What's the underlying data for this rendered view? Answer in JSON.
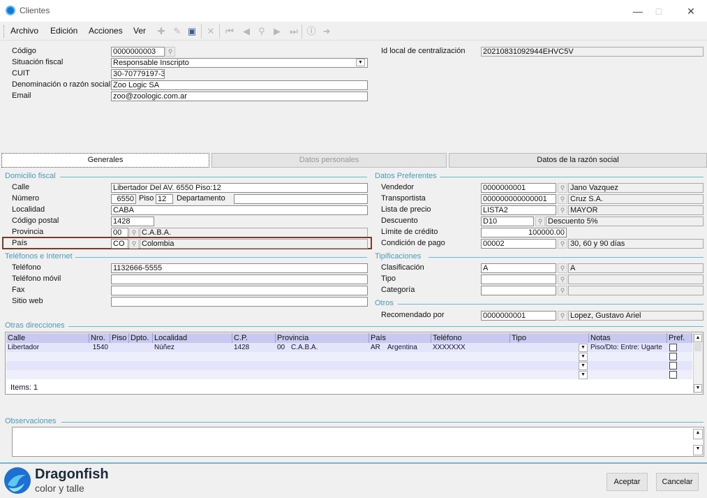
{
  "window": {
    "title": "Clientes",
    "minimize": "—",
    "maximize": "□",
    "close": "✕"
  },
  "menu": {
    "archivo": "Archivo",
    "edicion": "Edición",
    "acciones": "Acciones",
    "ver": "Ver"
  },
  "header": {
    "codigo_label": "Código",
    "codigo": "0000000003",
    "situacion_label": "Situación fiscal",
    "situacion": "Responsable Inscripto",
    "cuit_label": "CUIT",
    "cuit": "30-70779197-3",
    "denominacion_label": "Denominación o razón social",
    "denominacion": "Zoo Logic SA",
    "email_label": "Email",
    "email": "zoo@zoologic.com.ar",
    "idlocal_label": "Id local de centralización",
    "idlocal": "20210831092944EHVC5V"
  },
  "tabs": {
    "generales": "Generales",
    "personales": "Datos personales",
    "razon": "Datos de la razón social"
  },
  "domicilio": {
    "title": "Domicilio fiscal",
    "calle_label": "Calle",
    "calle": "Libertador Del AV. 6550 Piso:12",
    "numero_label": "Número",
    "numero": "6550",
    "piso_label": "Piso",
    "piso": "12",
    "depto_label": "Departamento",
    "depto": "",
    "localidad_label": "Localidad",
    "localidad": "CABA",
    "cp_label": "Código postal",
    "cp": "1428",
    "provincia_label": "Provincia",
    "provincia_code": "00",
    "provincia": "C.A.B.A.",
    "pais_label": "País",
    "pais_code": "CO",
    "pais": "Colombia"
  },
  "telefonos": {
    "title": "Teléfonos e Internet",
    "telefono_label": "Teléfono",
    "telefono": "1132666-5555",
    "movil_label": "Teléfono móvil",
    "movil": "",
    "fax_label": "Fax",
    "fax": "",
    "web_label": "Sitio web",
    "web": ""
  },
  "preferentes": {
    "title": "Datos Preferentes",
    "vendedor_label": "Vendedor",
    "vendedor_code": "0000000001",
    "vendedor": "Jano Vazquez",
    "transportista_label": "Transportista",
    "transportista_code": "000000000000001",
    "transportista": "Cruz S.A.",
    "lista_label": "Lista de precio",
    "lista_code": "LISTA2",
    "lista": "MAYOR",
    "descuento_label": "Descuento",
    "descuento_code": "D10",
    "descuento": "Descuento 5%",
    "limite_label": "Límite de crédito",
    "limite": "100000.00",
    "condicion_label": "Condición de pago",
    "condicion_code": "00002",
    "condicion": "30, 60 y 90 días"
  },
  "tipificaciones": {
    "title": "Tipificaciones",
    "clasificacion_label": "Clasificación",
    "clasificacion_code": "A",
    "clasificacion": "A",
    "tipo_label": "Tipo",
    "categoria_label": "Categoría"
  },
  "otros": {
    "title": "Otros",
    "recomendado_label": "Recomendado por",
    "recomendado_code": "0000000001",
    "recomendado": "Lopez, Gustavo Ariel"
  },
  "direcciones": {
    "title": "Otras direcciones",
    "columns": [
      "Calle",
      "Nro.",
      "Piso",
      "Dpto.",
      "Localidad",
      "C.P.",
      "Provincia",
      "País",
      "Teléfono",
      "Tipo",
      "Notas",
      "Pref."
    ],
    "row": {
      "calle": "Libertador",
      "nro": "1540",
      "piso": "",
      "dpto": "",
      "localidad": "Núñez",
      "cp": "1428",
      "prov_code": "00",
      "prov": "C.A.B.A.",
      "pais_code": "AR",
      "pais": "Argentina",
      "telefono": "XXXXXXX",
      "tipo": "",
      "notas": "Piso/Dto: Entre: Ugarte"
    },
    "items": "Items: 1"
  },
  "observaciones": {
    "title": "Observaciones"
  },
  "brand": {
    "name": "Dragonfish",
    "tagline": "color y talle"
  },
  "buttons": {
    "aceptar": "Aceptar",
    "cancelar": "Cancelar"
  },
  "colors": {
    "accent": "#6ab8d2",
    "highlight_box": "#7a3b24",
    "grid_header": "#c8c8f0"
  }
}
